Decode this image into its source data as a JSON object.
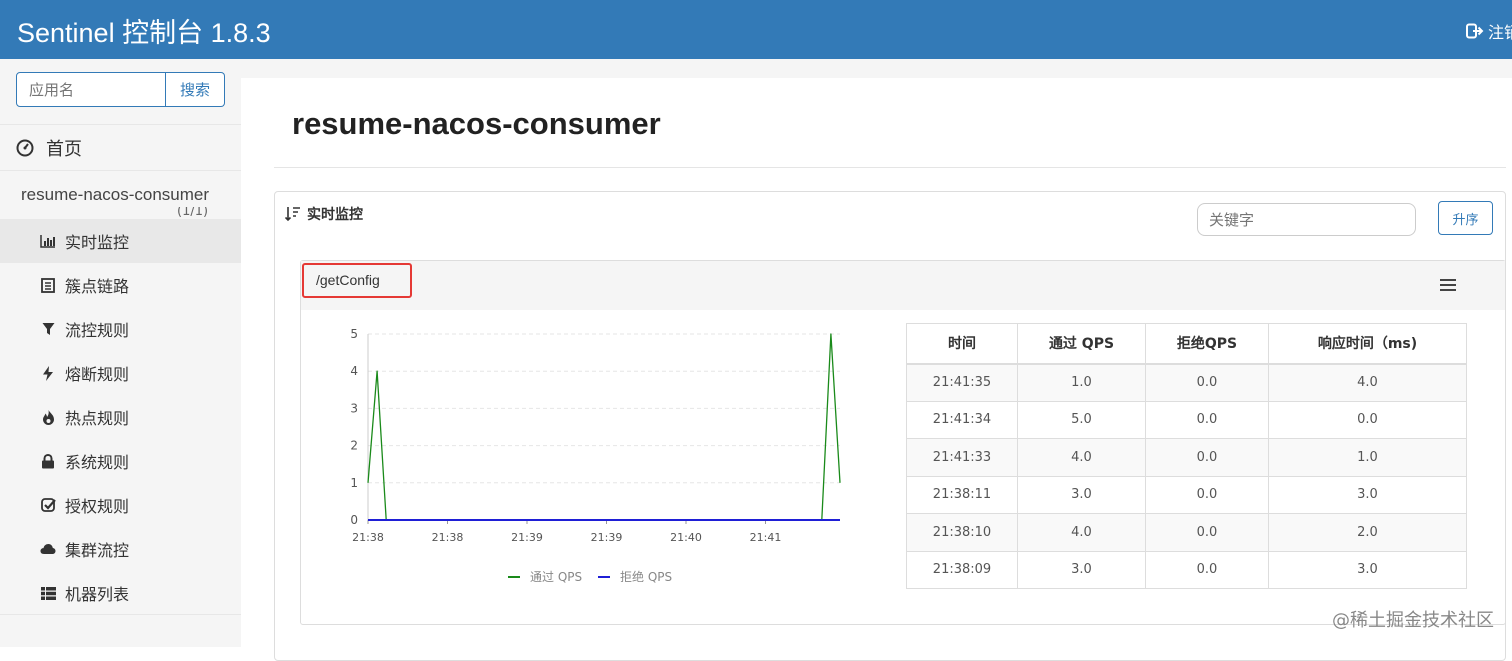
{
  "header": {
    "brand": "Sentinel 控制台 1.8.3",
    "logout_label": "注销",
    "logout_icon": "logout-icon",
    "bg_color": "#337ab7"
  },
  "sidebar": {
    "search_placeholder": "应用名",
    "search_button": "搜索",
    "home_label": "首页",
    "app_name": "resume-nacos-consumer",
    "app_count": "(1/1)",
    "items": [
      {
        "label": "实时监控",
        "icon": "bar-chart-icon",
        "active": true
      },
      {
        "label": "簇点链路",
        "icon": "list-icon"
      },
      {
        "label": "流控规则",
        "icon": "filter-icon"
      },
      {
        "label": "熔断规则",
        "icon": "flash-icon"
      },
      {
        "label": "热点规则",
        "icon": "fire-icon"
      },
      {
        "label": "系统规则",
        "icon": "lock-icon"
      },
      {
        "label": "授权规则",
        "icon": "check-icon"
      },
      {
        "label": "集群流控",
        "icon": "cloud-icon"
      },
      {
        "label": "机器列表",
        "icon": "th-list-icon"
      }
    ]
  },
  "main": {
    "title": "resume-nacos-consumer",
    "panel_title": "实时监控",
    "keyword_placeholder": "关键字",
    "sort_button": "升序",
    "resource": "/getConfig",
    "table": {
      "headers": [
        "时间",
        "通过 QPS",
        "拒绝QPS",
        "响应时间（ms)"
      ],
      "rows": [
        [
          "21:41:35",
          "1.0",
          "0.0",
          "4.0"
        ],
        [
          "21:41:34",
          "5.0",
          "0.0",
          "0.0"
        ],
        [
          "21:41:33",
          "4.0",
          "0.0",
          "1.0"
        ],
        [
          "21:38:11",
          "3.0",
          "0.0",
          "3.0"
        ],
        [
          "21:38:10",
          "4.0",
          "0.0",
          "2.0"
        ],
        [
          "21:38:09",
          "3.0",
          "0.0",
          "3.0"
        ]
      ]
    }
  },
  "chart_data": {
    "type": "line",
    "x_tick_labels": [
      "21:38",
      "21:38",
      "21:39",
      "21:39",
      "21:40",
      "21:41"
    ],
    "y_tick_labels": [
      "0",
      "1",
      "2",
      "3",
      "4",
      "5"
    ],
    "ylim": [
      0,
      5
    ],
    "grid": true,
    "legend_position": "bottom",
    "series": [
      {
        "name": "通过 QPS",
        "color": "#1a8a1a",
        "points": [
          [
            0,
            1
          ],
          [
            1,
            4
          ],
          [
            2,
            0
          ],
          [
            3,
            0
          ],
          [
            50,
            0
          ],
          [
            51,
            5
          ],
          [
            52,
            1
          ]
        ]
      },
      {
        "name": "拒绝 QPS",
        "color": "#1f1fd6",
        "points": [
          [
            0,
            0
          ],
          [
            52,
            0
          ]
        ]
      }
    ]
  },
  "watermark": "@稀土掘金技术社区"
}
